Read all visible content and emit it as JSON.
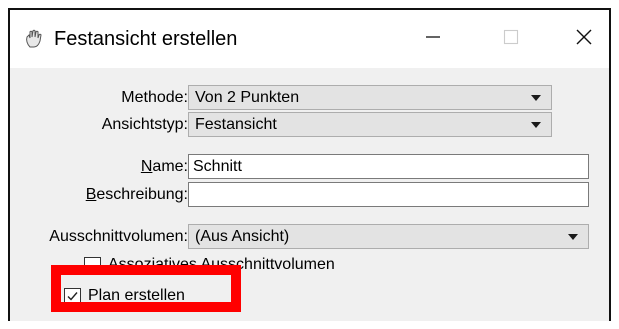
{
  "window": {
    "title": "Festansicht erstellen",
    "icon": "microstation-hand-icon",
    "controls": {
      "minimize": "minimize-icon",
      "maximize": "maximize-icon",
      "close": "close-icon"
    }
  },
  "form": {
    "methode": {
      "label": "Methode:",
      "value": "Von 2 Punkten"
    },
    "ansichtstyp": {
      "label": "Ansichtstyp:",
      "value": "Festansicht"
    },
    "name": {
      "label_underline": "N",
      "label_rest": "ame:",
      "value": "Schnitt"
    },
    "beschreibung": {
      "label_underline": "B",
      "label_rest": "eschreibung:",
      "value": ""
    },
    "ausschnittvolumen": {
      "label": "Ausschnittvolumen:",
      "value": "(Aus Ansicht)"
    },
    "assoziatives": {
      "label": "Assoziatives Ausschnittvolumen",
      "checked": false
    },
    "plan": {
      "label": "Plan erstellen",
      "checked": true
    }
  },
  "highlight": {
    "color": "#ff0000"
  },
  "colors": {
    "combo_bg": "#e3e3e3",
    "form_bg": "#f0f0f0"
  }
}
